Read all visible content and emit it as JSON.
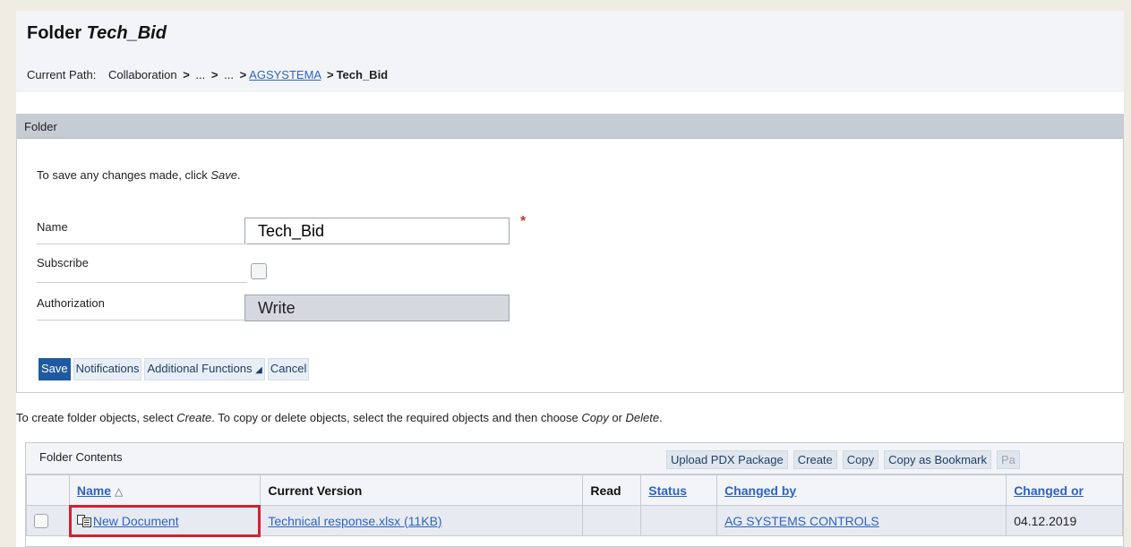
{
  "header": {
    "title_prefix": "Folder ",
    "title_name": "Tech_Bid",
    "path_label": "Current Path:",
    "path_items": [
      "Collaboration",
      "...",
      "...",
      "AGSYSTEMA",
      "Tech_Bid"
    ],
    "path_separator": ">"
  },
  "folder_panel": {
    "title": "Folder",
    "intro_prefix": "To save any changes made, click ",
    "intro_action": "Save",
    "intro_suffix": ".",
    "fields": {
      "name_label": "Name",
      "name_value": "Tech_Bid",
      "required_mark": "*",
      "subscribe_label": "Subscribe",
      "authorization_label": "Authorization",
      "authorization_value": "Write"
    },
    "buttons": {
      "save": "Save",
      "notifications": "Notifications",
      "additional_functions": "Additional Functions",
      "dropdown_glyph": "◢",
      "cancel": "Cancel"
    }
  },
  "instructions": {
    "part1": "To create folder objects, select ",
    "create": "Create",
    "part2": ". To copy or delete objects, select the required objects and then choose ",
    "copy": "Copy",
    "or": " or ",
    "delete": "Delete",
    "end": "."
  },
  "contents": {
    "title": "Folder Contents",
    "toolbar": [
      "Upload PDX Package",
      "Create",
      "Copy",
      "Copy as Bookmark",
      "Pa"
    ],
    "columns": {
      "name": "Name",
      "sort_glyph": "△",
      "current_version": "Current Version",
      "read": "Read",
      "status": "Status",
      "changed_by": "Changed by",
      "changed_on": "Changed or"
    },
    "rows": [
      {
        "name": "New Document",
        "current_version": "Technical response.xlsx (11KB)",
        "read": "",
        "status": "",
        "changed_by": "AG SYSTEMS CONTROLS",
        "changed_on": "04.12.2019"
      }
    ]
  },
  "colors": {
    "accent_blue": "#1f5aa0",
    "link_blue": "#2e63c2",
    "highlight_red": "#d42030"
  }
}
